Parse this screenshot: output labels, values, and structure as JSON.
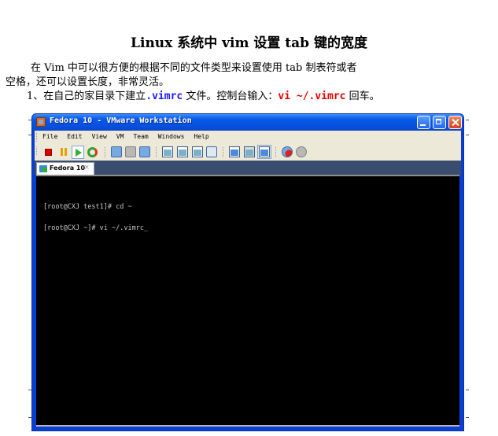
{
  "document": {
    "title": "Linux 系统中 vim 设置 tab 键的宽度",
    "intro_line1": "在 Vim 中可以很方便的根据不同的文件类型来设置使用 tab 制表符或者",
    "intro_line2": "空格，还可以设置长度，非常灵活。",
    "step1": {
      "prefix": "1、在自己的家目录下建立",
      "filename": ".vimrc",
      "middle": " 文件。控制台输入：",
      "command": "vi ~/.vimrc",
      "suffix": " 回车。"
    },
    "colors": {
      "filename": "#1a1aff",
      "command": "#e60000"
    }
  },
  "vmware": {
    "window_title": "Fedora 10 - VMware Workstation",
    "menu": [
      "File",
      "Edit",
      "View",
      "VM",
      "Team",
      "Windows",
      "Help"
    ],
    "toolbar_icons": [
      "power-off-icon",
      "suspend-icon",
      "power-on-icon",
      "reset-icon",
      "take-snapshot-icon",
      "revert-snapshot-icon",
      "snapshot-manager-icon",
      "show-sidebar-icon",
      "full-screen-icon",
      "quick-switch-icon",
      "unity-icon",
      "console-view-icon",
      "thumbnail-view-icon",
      "summary-view-icon",
      "record-icon",
      "replay-icon"
    ],
    "tab_label": "Fedora 10",
    "tab_close": "×",
    "terminal_lines": [
      "[root@CXJ test1]# cd ~",
      "[root@CXJ ~]# vi ~/.vimrc_"
    ]
  }
}
